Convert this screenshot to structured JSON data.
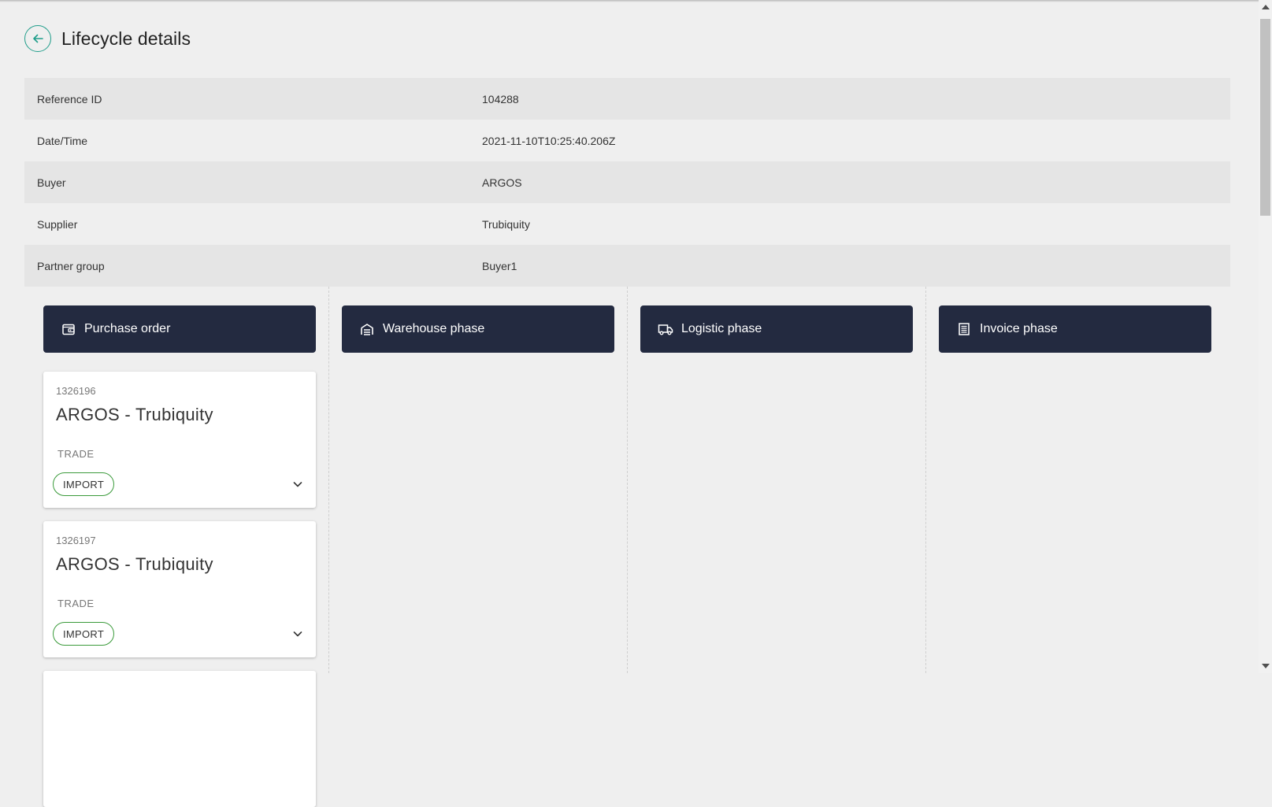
{
  "header": {
    "title": "Lifecycle details"
  },
  "details": [
    {
      "label": "Reference ID",
      "value": "104288"
    },
    {
      "label": "Date/Time",
      "value": "2021-11-10T10:25:40.206Z"
    },
    {
      "label": "Buyer",
      "value": "ARGOS"
    },
    {
      "label": "Supplier",
      "value": "Trubiquity"
    },
    {
      "label": "Partner group",
      "value": "Buyer1"
    }
  ],
  "phases": [
    {
      "label": "Purchase order",
      "icon": "wallet-icon"
    },
    {
      "label": "Warehouse phase",
      "icon": "warehouse-icon"
    },
    {
      "label": "Logistic phase",
      "icon": "truck-icon"
    },
    {
      "label": "Invoice phase",
      "icon": "invoice-icon"
    }
  ],
  "orders": [
    {
      "ref": "1326196",
      "title": "ARGOS - Trubiquity",
      "type": "TRADE",
      "chip": "IMPORT"
    },
    {
      "ref": "1326197",
      "title": "ARGOS - Trubiquity",
      "type": "TRADE",
      "chip": "IMPORT"
    }
  ],
  "colors": {
    "header_bg": "#232a40",
    "accent": "#1f9d8a",
    "chip_border": "#3a9a3a",
    "page_bg": "#efefef"
  }
}
